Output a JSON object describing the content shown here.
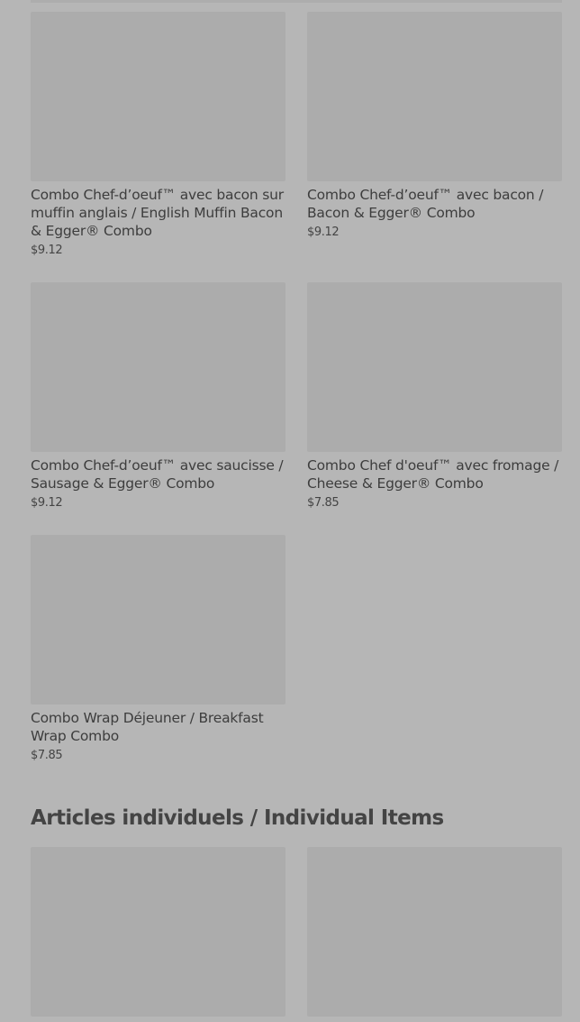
{
  "combos": [
    {
      "name": "Combo Chef-d’oeuf™ avec bacon sur muffin anglais / English Muffin Bacon & Egger® Combo",
      "price": "$9.12"
    },
    {
      "name": "Combo Chef-d’oeuf™ avec bacon / Bacon & Egger® Combo",
      "price": "$9.12"
    },
    {
      "name": "Combo Chef-d’oeuf™ avec saucisse / Sausage & Egger® Combo",
      "price": "$9.12"
    },
    {
      "name": "Combo Chef d'oeuf™ avec fromage / Cheese & Egger® Combo",
      "price": "$7.85"
    },
    {
      "name": "Combo Wrap Déjeuner / Breakfast Wrap Combo",
      "price": "$7.85"
    }
  ],
  "individual_section": {
    "title": "Articles individuels / Individual Items"
  }
}
